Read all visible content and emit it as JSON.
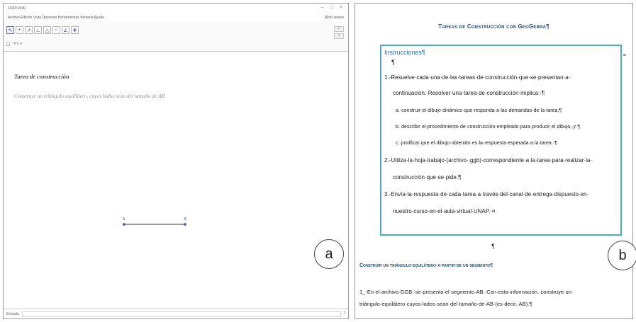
{
  "geogebra": {
    "window_title": "1160×1040",
    "window_controls": [
      "–",
      "□",
      "×"
    ],
    "menubar_text": "Archivo Edición Vista Opciones Herramientas Ventana Ayuda",
    "signin": "Abrir sesión",
    "tools": [
      "pointer-tool-icon",
      "point-tool-icon",
      "line-tool-icon",
      "perpendicular-tool-icon",
      "polygon-tool-icon",
      "circle-tool-icon",
      "angle-tool-icon",
      "move-view-tool-icon"
    ],
    "style_bar": "A C ▾",
    "task_title": "Tarea de construcción",
    "task_text": "Construye un triángulo equilátero, cuyos lados sean del tamaño de AB",
    "point_a": "A",
    "point_b": "B",
    "input_label": "Entrada",
    "input_help": "?"
  },
  "markers": {
    "a": "a",
    "b": "b"
  },
  "document": {
    "title": "Tareas de Construcción con GeoGebra¶",
    "instructions_heading": "Instrucciones¶",
    "pilcrow": "¶",
    "corner_mark": "¤",
    "items": [
      "1.-Resuelve·cada·una·de·las·tareas·de·construcción·que·se·presentan·a·",
      "continuación.·Resolver·una·tarea·de·construcción·implica:·¶",
      "a.·construir·el·dibujo·dinámico·que·responda·a·las·demandas·de·la·tarea,¶",
      "b.·describir·el·procedimiento·de·construcción·empleado·para·producir·el·dibujo,·y·¶",
      "c.·justificar·que·el·dibujo·obtenido·es·la·respuesta·esperada·a·la·tarea.·¶",
      "2.-Utiliza·la·hoja·trabajo·(archivo·.ggb)·correspondiente·a·la·tarea·para·realizar·la·",
      "construcción·que·se·pide.¶",
      "3.-Envía·la·respuesta·de·cada·tarea·a·través·del·canal·de·entrega·dispuesto·en·",
      "nuestro·curso·en·el·aula·virtual·UNAP.·¤"
    ],
    "section_heading": "Construir·un·triángulo·equilátero·a·partir·de·un·segmento¶",
    "section_body_1": "1_-En·el·archivo·GGB.·se·presenta·el·segmento·AB.·Con·esta·información,·construye·un·",
    "section_body_2": "triángulo·equilátero·cuyos·lados·sean·del·tamaño·de·AB·(es·decir,·AB).¶"
  }
}
